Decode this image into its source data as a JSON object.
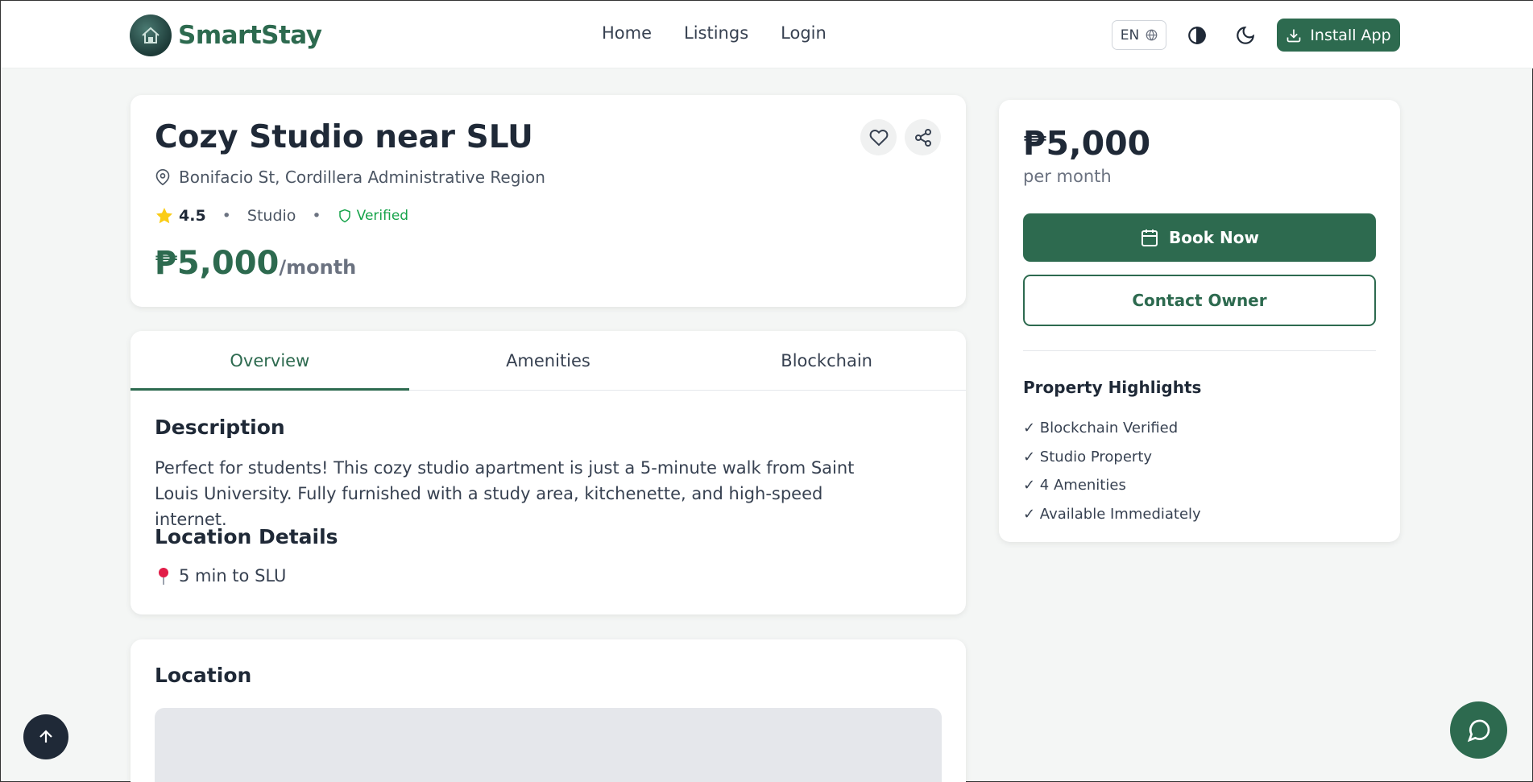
{
  "header": {
    "brand": "SmartStay",
    "nav": [
      "Home",
      "Listings",
      "Login"
    ],
    "language": "EN",
    "install_label": "Install App"
  },
  "listing": {
    "title": "Cozy Studio near SLU",
    "address": "Bonifacio St, Cordillera Administrative Region",
    "rating": "4.5",
    "type": "Studio",
    "verified_label": "Verified",
    "price": "₱5,000",
    "price_period": "/month"
  },
  "tabs": [
    "Overview",
    "Amenities",
    "Blockchain"
  ],
  "overview": {
    "description_heading": "Description",
    "description": "Perfect for students! This cozy studio apartment is just a 5-minute walk from Saint Louis University. Fully furnished with a study area, kitchenette, and high-speed internet.",
    "location_heading": "Location Details",
    "location_item": "5 min to SLU"
  },
  "location_section": {
    "heading": "Location"
  },
  "sidebar": {
    "price": "₱5,000",
    "period": "per month",
    "book_label": "Book Now",
    "contact_label": "Contact Owner",
    "highlights_title": "Property Highlights",
    "highlights": [
      "✓ Blockchain Verified",
      "✓ Studio Property",
      "✓ 4 Amenities",
      "✓ Available Immediately"
    ]
  },
  "colors": {
    "primary": "#2d6a4f",
    "verified": "#16a34a",
    "star": "#facc15"
  }
}
